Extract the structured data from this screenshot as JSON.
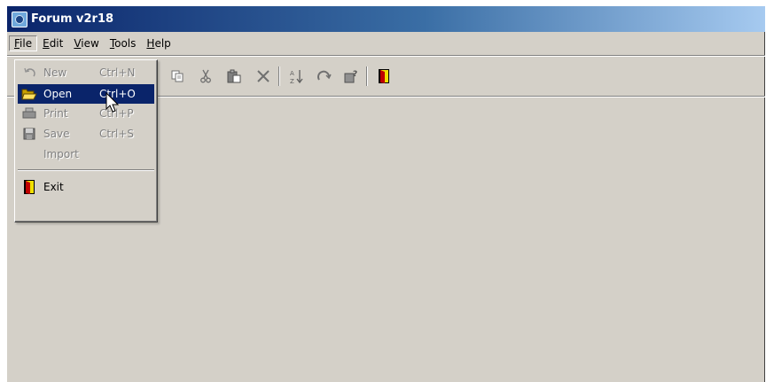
{
  "window": {
    "title": "Forum v2r18"
  },
  "menubar": {
    "items": [
      {
        "label": "File",
        "mnemonic": "F",
        "rest": "ile"
      },
      {
        "label": "Edit",
        "mnemonic": "E",
        "rest": "dit"
      },
      {
        "label": "View",
        "mnemonic": "V",
        "rest": "iew"
      },
      {
        "label": "Tools",
        "mnemonic": "T",
        "rest": "ools"
      },
      {
        "label": "Help",
        "mnemonic": "H",
        "rest": "elp"
      }
    ]
  },
  "file_menu": {
    "items": [
      {
        "label": "New",
        "shortcut": "Ctrl+N",
        "icon": "undo-arrow-icon",
        "enabled": false
      },
      {
        "label": "Open",
        "shortcut": "Ctrl+O",
        "icon": "open-folder-icon",
        "enabled": true,
        "highlighted": true
      },
      {
        "label": "Print",
        "shortcut": "Ctrl+P",
        "icon": "printer-icon",
        "enabled": false
      },
      {
        "label": "Save",
        "shortcut": "Ctrl+S",
        "icon": "floppy-disk-icon",
        "enabled": false
      },
      {
        "label": "Import",
        "shortcut": "",
        "icon": "",
        "enabled": false
      },
      {
        "label": "Exit",
        "shortcut": "",
        "icon": "exit-door-icon",
        "enabled": true
      }
    ]
  },
  "toolbar": {
    "buttons": [
      "copy-icon",
      "cut-icon",
      "paste-icon",
      "delete-icon",
      "sort-icon",
      "redo-icon",
      "help-query-icon",
      "exit-door-icon"
    ]
  },
  "colors": {
    "titlebar_start": "#0a246a",
    "titlebar_end": "#a6caf0",
    "highlight": "#0a246a",
    "face": "#d4d0c8"
  }
}
